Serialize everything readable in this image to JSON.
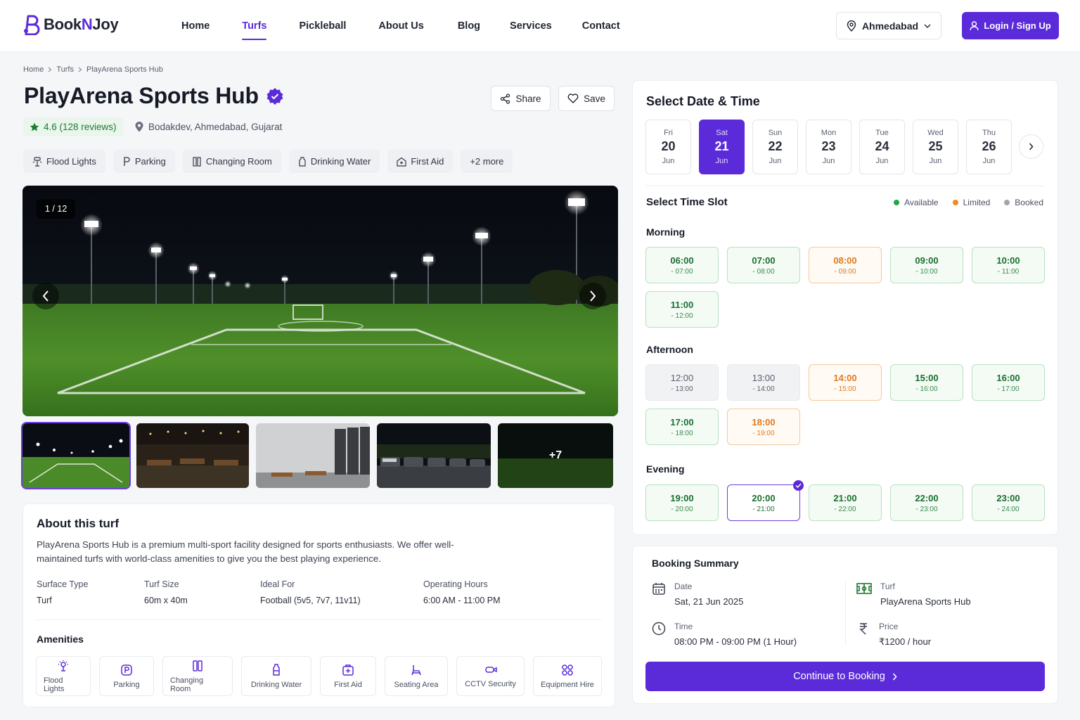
{
  "brand": {
    "name_a": "Book",
    "name_b": "N",
    "name_c": "Joy",
    "accent": "#5b2bd9"
  },
  "nav": [
    {
      "label": "Home",
      "active": false
    },
    {
      "label": "Turfs",
      "active": true
    },
    {
      "label": "Pickleball",
      "active": false
    },
    {
      "label": "About Us",
      "active": false
    },
    {
      "label": "Blog",
      "active": false
    },
    {
      "label": "Services",
      "active": false
    },
    {
      "label": "Contact",
      "active": false
    }
  ],
  "location": {
    "label": "Ahmedabad"
  },
  "auth": {
    "label": "Login / Sign Up"
  },
  "breadcrumb": {
    "home": "Home",
    "turfs": "Turfs",
    "current": "PlayArena Sports Hub"
  },
  "venue": {
    "title": "PlayArena Sports Hub",
    "rating": "4.6 (128 reviews)",
    "address": "Bodakdev, Ahmedabad, Gujarat",
    "share": "Share",
    "save": "Save"
  },
  "chips": [
    "Flood Lights",
    "Parking",
    "Changing Room",
    "Drinking Water",
    "First Aid",
    "+2 more"
  ],
  "gallery": {
    "counter": "1 / 12",
    "more": "+7"
  },
  "about": {
    "title": "About this turf",
    "description": "PlayArena Sports Hub is a premium multi-sport facility designed for sports enthusiasts. We offer well-maintained turfs with world-class amenities to give you the best playing experience.",
    "specs": [
      {
        "k": "Surface Type",
        "v": "Turf"
      },
      {
        "k": "Turf Size",
        "v": "60m x 40m"
      },
      {
        "k": "Ideal For",
        "v": "Football (5v5, 7v7, 11v11)"
      },
      {
        "k": "Operating Hours",
        "v": "6:00 AM - 11:00 PM"
      }
    ],
    "amenities_title": "Amenities",
    "amenities": [
      "Flood Lights",
      "Parking",
      "Changing Room",
      "Drinking Water",
      "First Aid",
      "Seating Area",
      "CCTV Security",
      "Equipment Hire"
    ]
  },
  "booking": {
    "title": "Select Date & Time",
    "dates": [
      {
        "dw": "Fri",
        "dn": "20",
        "dm": "Jun"
      },
      {
        "dw": "Sat",
        "dn": "21",
        "dm": "Jun"
      },
      {
        "dw": "Sun",
        "dn": "22",
        "dm": "Jun"
      },
      {
        "dw": "Mon",
        "dn": "23",
        "dm": "Jun"
      },
      {
        "dw": "Tue",
        "dn": "24",
        "dm": "Jun"
      },
      {
        "dw": "Wed",
        "dn": "25",
        "dm": "Jun"
      },
      {
        "dw": "Thu",
        "dn": "26",
        "dm": "Jun"
      }
    ],
    "selected_date_index": 1,
    "slot_title": "Select Time Slot",
    "legend": {
      "available": "Available",
      "limited": "Limited",
      "booked": "Booked"
    },
    "colors": {
      "available": "#22a447",
      "limited": "#f08a24",
      "booked": "#a0a4ad"
    },
    "morning_label": "Morning",
    "afternoon_label": "Afternoon",
    "evening_label": "Evening",
    "morning": [
      {
        "from": "06:00",
        "to": "- 07:00",
        "status": "av"
      },
      {
        "from": "07:00",
        "to": "- 08:00",
        "status": "av"
      },
      {
        "from": "08:00",
        "to": "- 09:00",
        "status": "lim"
      },
      {
        "from": "09:00",
        "to": "- 10:00",
        "status": "av"
      },
      {
        "from": "10:00",
        "to": "- 11:00",
        "status": "av"
      },
      {
        "from": "11:00",
        "to": "- 12:00",
        "status": "av"
      }
    ],
    "afternoon": [
      {
        "from": "12:00",
        "to": "- 13:00",
        "status": "bk"
      },
      {
        "from": "13:00",
        "to": "- 14:00",
        "status": "bk"
      },
      {
        "from": "14:00",
        "to": "- 15:00",
        "status": "lim"
      },
      {
        "from": "15:00",
        "to": "- 16:00",
        "status": "av"
      },
      {
        "from": "16:00",
        "to": "- 17:00",
        "status": "av"
      },
      {
        "from": "17:00",
        "to": "- 18:00",
        "status": "av"
      },
      {
        "from": "18:00",
        "to": "- 19:00",
        "status": "lim"
      }
    ],
    "evening": [
      {
        "from": "19:00",
        "to": "- 20:00",
        "status": "av"
      },
      {
        "from": "20:00",
        "to": "- 21:00",
        "status": "sel"
      },
      {
        "from": "21:00",
        "to": "- 22:00",
        "status": "av"
      },
      {
        "from": "22:00",
        "to": "- 23:00",
        "status": "av"
      },
      {
        "from": "23:00",
        "to": "- 24:00",
        "status": "av"
      }
    ]
  },
  "summary": {
    "title": "Booking Summary",
    "date_k": "Date",
    "date_v": "Sat, 21 Jun 2025",
    "turf_k": "Turf",
    "turf_v": "PlayArena Sports Hub",
    "time_k": "Time",
    "time_v": "08:00 PM - 09:00 PM (1 Hour)",
    "price_k": "Price",
    "price_v": "₹1200 / hour",
    "cta": "Continue to Booking"
  }
}
